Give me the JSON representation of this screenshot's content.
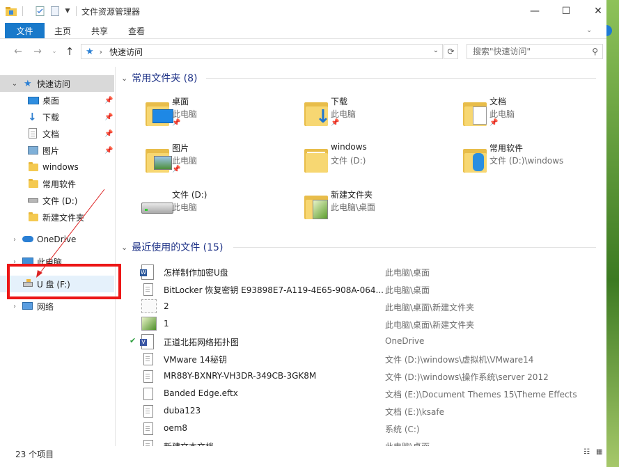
{
  "window": {
    "title": "文件资源管理器",
    "controls": {
      "minimize": "—",
      "maximize": "☐",
      "close": "✕"
    }
  },
  "ribbon": {
    "file_tab": "文件",
    "tabs": [
      "主页",
      "共享",
      "查看"
    ]
  },
  "address": {
    "path": "快速访问",
    "separator": "›",
    "search_placeholder": "搜索\"快速访问\""
  },
  "nav": {
    "quick_access": "快速访问",
    "items": [
      {
        "label": "桌面",
        "icon": "desktop-icon",
        "pinned": true
      },
      {
        "label": "下载",
        "icon": "download-icon",
        "pinned": true
      },
      {
        "label": "文档",
        "icon": "document-icon",
        "pinned": true
      },
      {
        "label": "图片",
        "icon": "pictures-icon",
        "pinned": true
      },
      {
        "label": "windows",
        "icon": "folder-icon",
        "pinned": false
      },
      {
        "label": "常用软件",
        "icon": "folder-icon",
        "pinned": false
      },
      {
        "label": "文件 (D:)",
        "icon": "drive-icon",
        "pinned": false
      },
      {
        "label": "新建文件夹",
        "icon": "folder-icon",
        "pinned": false
      }
    ],
    "onedrive": "OneDrive",
    "this_pc": "此电脑",
    "usb": "U 盘 (F:)",
    "network": "网络"
  },
  "frequent": {
    "header": "常用文件夹 (8)",
    "tiles": [
      {
        "name": "桌面",
        "location": "此电脑",
        "pinned": true,
        "icon": "desktop-folder-icon"
      },
      {
        "name": "下载",
        "location": "此电脑",
        "pinned": true,
        "icon": "download-folder-icon"
      },
      {
        "name": "文档",
        "location": "此电脑",
        "pinned": true,
        "icon": "documents-folder-icon"
      },
      {
        "name": "图片",
        "location": "此电脑",
        "pinned": true,
        "icon": "pictures-folder-icon"
      },
      {
        "name": "windows",
        "location": "文件 (D:)",
        "pinned": false,
        "icon": "folder-icon"
      },
      {
        "name": "常用软件",
        "location": "文件 (D:)\\windows",
        "pinned": false,
        "icon": "software-folder-icon"
      },
      {
        "name": "文件 (D:)",
        "location": "此电脑",
        "pinned": false,
        "icon": "drive-icon"
      },
      {
        "name": "新建文件夹",
        "location": "此电脑\\桌面",
        "pinned": false,
        "icon": "image-folder-icon"
      }
    ]
  },
  "recent": {
    "header": "最近使用的文件 (15)",
    "files": [
      {
        "name": "怎样制作加密U盘",
        "path": "此电脑\\桌面",
        "icon": "word-doc-icon",
        "synced": false
      },
      {
        "name": "BitLocker 恢复密钥 E93898E7-A119-4E65-908A-064...",
        "path": "此电脑\\桌面",
        "icon": "text-file-icon",
        "synced": false
      },
      {
        "name": "2",
        "path": "此电脑\\桌面\\新建文件夹",
        "icon": "image-file-icon",
        "synced": false
      },
      {
        "name": "1",
        "path": "此电脑\\桌面\\新建文件夹",
        "icon": "image-file-icon",
        "synced": false
      },
      {
        "name": "正道北拓网络拓扑图",
        "path": "OneDrive",
        "icon": "visio-doc-icon",
        "synced": true
      },
      {
        "name": "VMware 14秘钥",
        "path": "文件 (D:)\\windows\\虚拟机\\VMware14",
        "icon": "text-file-icon",
        "synced": false
      },
      {
        "name": "MR88Y-BXNRY-VH3DR-349CB-3GK8M",
        "path": "文件 (D:)\\windows\\操作系统\\server 2012",
        "icon": "text-file-icon",
        "synced": false
      },
      {
        "name": "Banded Edge.eftx",
        "path": "文档 (E:)\\Document Themes 15\\Theme Effects",
        "icon": "blank-file-icon",
        "synced": false
      },
      {
        "name": "duba123",
        "path": "文档 (E:)\\ksafe",
        "icon": "text-file-icon",
        "synced": false
      },
      {
        "name": "oem8",
        "path": "系统 (C:)",
        "icon": "text-file-icon",
        "synced": false
      },
      {
        "name": "新建文本文档",
        "path": "此电脑\\桌面",
        "icon": "text-file-icon",
        "synced": false
      }
    ]
  },
  "status": {
    "count": "23 个项目"
  },
  "colors": {
    "accent": "#1979ca",
    "header": "#1e3287",
    "highlight": "#ec1616"
  }
}
